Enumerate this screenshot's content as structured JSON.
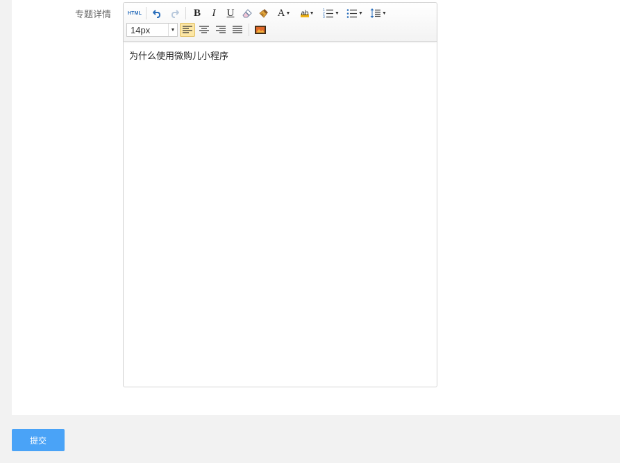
{
  "form": {
    "field_label": "专题详情",
    "submit_label": "提交"
  },
  "editor": {
    "font_size": "14px",
    "content_text": "为什么使用微购儿小程序",
    "toolbar": {
      "html_label": "HTML",
      "bold_label": "B",
      "italic_label": "I",
      "underline_label": "U",
      "font_color_label": "A",
      "highlight_label": "ab"
    },
    "active_tool": "align-left",
    "colors": {
      "active_bg": "#fde7a5",
      "submit_bg": "#4aa3f7"
    }
  }
}
